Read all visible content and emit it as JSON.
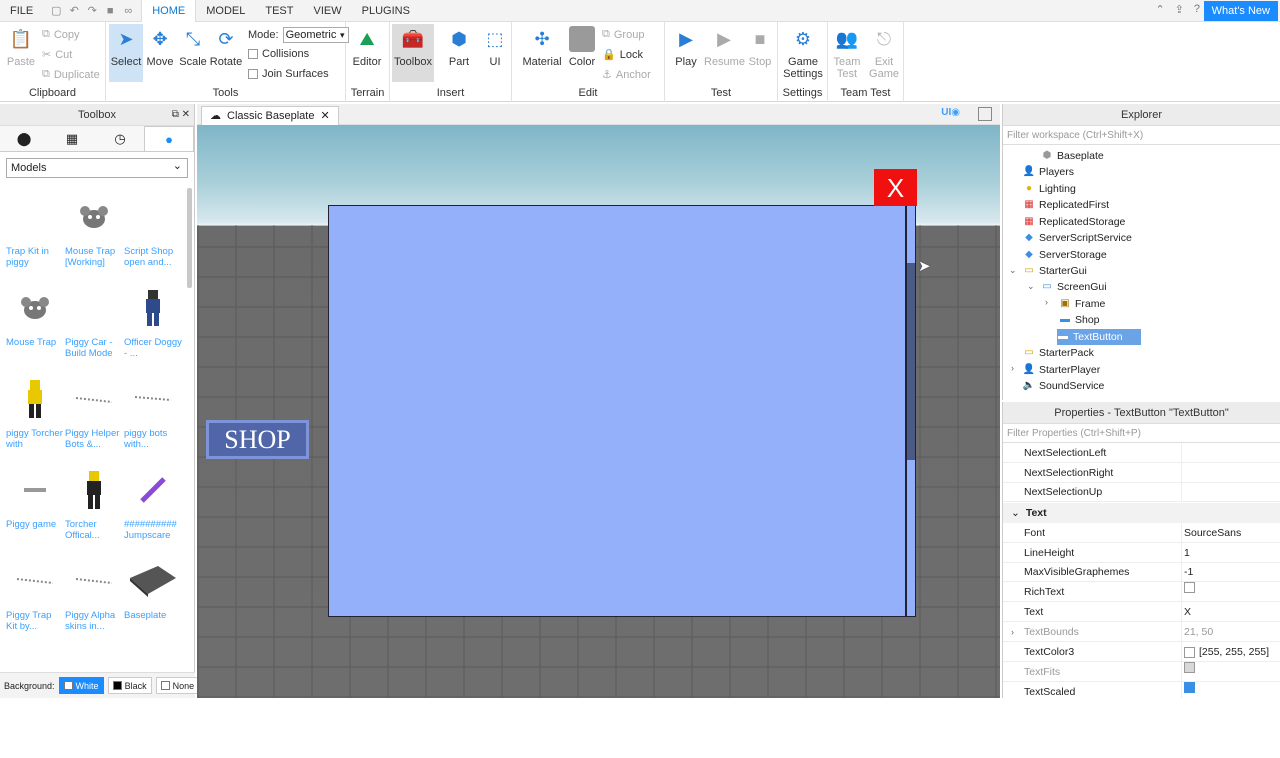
{
  "menubar": {
    "items": [
      "FILE",
      "HOME",
      "MODEL",
      "TEST",
      "VIEW",
      "PLUGINS"
    ],
    "active": "HOME",
    "whats_new": "What's New"
  },
  "ribbon": {
    "clipboard": {
      "paste": "Paste",
      "copy": "Copy",
      "cut": "Cut",
      "duplicate": "Duplicate",
      "label": "Clipboard"
    },
    "tools": {
      "select": "Select",
      "move": "Move",
      "scale": "Scale",
      "rotate": "Rotate",
      "mode_label": "Mode:",
      "mode_value": "Geometric",
      "collisions": "Collisions",
      "join_surfaces": "Join Surfaces",
      "label": "Tools"
    },
    "terrain": {
      "editor": "Editor",
      "label": "Terrain"
    },
    "insert": {
      "toolbox": "Toolbox",
      "part": "Part",
      "ui": "UI",
      "label": "Insert"
    },
    "edit": {
      "material": "Material",
      "color": "Color",
      "group": "Group",
      "lock": "Lock",
      "anchor": "Anchor",
      "label": "Edit"
    },
    "test": {
      "play": "Play",
      "resume": "Resume",
      "stop": "Stop",
      "label": "Test"
    },
    "settings": {
      "game_settings_1": "Game",
      "game_settings_2": "Settings",
      "label": "Settings"
    },
    "team_test": {
      "team_test_1": "Team",
      "team_test_2": "Test",
      "exit_game_1": "Exit",
      "exit_game_2": "Game",
      "label": "Team Test"
    }
  },
  "toolbox": {
    "title": "Toolbox",
    "category": "Models",
    "items": [
      {
        "name": "Trap Kit in piggy"
      },
      {
        "name": "Mouse Trap [Working]"
      },
      {
        "name": "Script Shop open and..."
      },
      {
        "name": "Mouse Trap"
      },
      {
        "name": "Piggy Car - Build Mode"
      },
      {
        "name": "Officer Doggy - ..."
      },
      {
        "name": "piggy Torcher with"
      },
      {
        "name": "Piggy Helper Bots &..."
      },
      {
        "name": "piggy bots with..."
      },
      {
        "name": "Piggy game"
      },
      {
        "name": "Torcher Offical..."
      },
      {
        "name": "########## Jumpscare"
      },
      {
        "name": "Piggy Trap Kit by..."
      },
      {
        "name": "Piggy Alpha skins in..."
      },
      {
        "name": "Baseplate"
      }
    ],
    "background_label": "Background:",
    "bg_white": "White",
    "bg_black": "Black",
    "bg_none": "None"
  },
  "document": {
    "tab_title": "Classic Baseplate",
    "ui_toggle": "UI"
  },
  "viewport": {
    "close_text": "X",
    "shop_text": "SHOP",
    "colors": {
      "frame": "#94b0fa",
      "close": "#f01010",
      "shop": "#5066a8"
    }
  },
  "explorer": {
    "title": "Explorer",
    "filter_placeholder": "Filter workspace (Ctrl+Shift+X)",
    "rows": [
      {
        "label": "Baseplate"
      },
      {
        "label": "Players"
      },
      {
        "label": "Lighting"
      },
      {
        "label": "ReplicatedFirst"
      },
      {
        "label": "ReplicatedStorage"
      },
      {
        "label": "ServerScriptService"
      },
      {
        "label": "ServerStorage"
      },
      {
        "label": "StarterGui"
      },
      {
        "label": "ScreenGui"
      },
      {
        "label": "Frame"
      },
      {
        "label": "Shop"
      },
      {
        "label": "TextButton"
      },
      {
        "label": "StarterPack"
      },
      {
        "label": "StarterPlayer"
      },
      {
        "label": "SoundService"
      }
    ]
  },
  "properties": {
    "title": "Properties - TextButton \"TextButton\"",
    "filter_placeholder": "Filter Properties (Ctrl+Shift+P)",
    "rows_top": [
      {
        "name": "NextSelectionLeft",
        "value": ""
      },
      {
        "name": "NextSelectionRight",
        "value": ""
      },
      {
        "name": "NextSelectionUp",
        "value": ""
      }
    ],
    "section": "Text",
    "rows_text": [
      {
        "name": "Font",
        "value": "SourceSans"
      },
      {
        "name": "LineHeight",
        "value": "1"
      },
      {
        "name": "MaxVisibleGraphemes",
        "value": "-1"
      },
      {
        "name": "RichText",
        "value": ""
      },
      {
        "name": "Text",
        "value": "X"
      },
      {
        "name": "TextBounds",
        "value": "21, 50"
      },
      {
        "name": "TextColor3",
        "value": "[255, 255, 255]"
      },
      {
        "name": "TextFits",
        "value": ""
      },
      {
        "name": "TextScaled",
        "value": ""
      }
    ]
  }
}
